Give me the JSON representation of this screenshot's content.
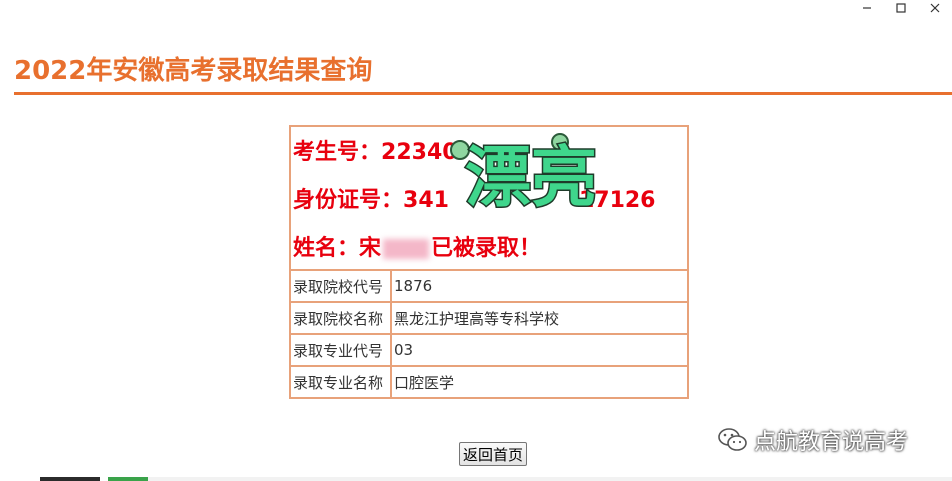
{
  "window": {
    "minimize_glyph": "–",
    "maximize_glyph": "□",
    "close_glyph": "✕"
  },
  "page": {
    "title": "2022年安徽高考录取结果查询"
  },
  "result": {
    "exam_no_label": "考生号：",
    "exam_no_value": "22340",
    "id_label": "身份证号：",
    "id_prefix": "341",
    "id_suffix": "17126",
    "name_label": "姓名：",
    "name_visible": "宋",
    "status_text": "已被录取！",
    "rows": [
      {
        "label": "录取院校代号",
        "value": "1876"
      },
      {
        "label": "录取院校名称",
        "value": "黑龙江护理高等专科学校"
      },
      {
        "label": "录取专业代号",
        "value": "03"
      },
      {
        "label": "录取专业名称",
        "value": "口腔医学"
      }
    ]
  },
  "sticker": {
    "text": "漂亮",
    "color": "#3fd68c"
  },
  "actions": {
    "back_label": "返回首页"
  },
  "watermark": {
    "text": "点航教育说高考"
  },
  "colors": {
    "accent": "#e8702e",
    "table_border": "#e8a27a",
    "highlight_red": "#e8000e"
  }
}
